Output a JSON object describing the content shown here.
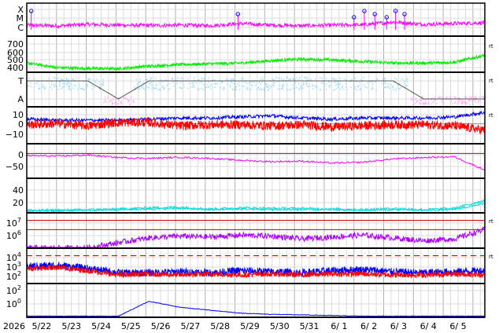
{
  "chart_data": {
    "type": "line",
    "x_axis": {
      "year_label": "2026",
      "day_labels": [
        "5/22",
        "5/23",
        "5/24",
        "5/25",
        "5/26",
        "5/27",
        "5/28",
        "5/29",
        "5/30",
        "5/31",
        "6/ 1",
        "6/ 2",
        "6/ 3",
        "6/ 4",
        "6/ 5"
      ],
      "range_days": [
        0,
        15.4
      ]
    },
    "colors": {
      "magenta": "#ff00ff",
      "green": "#00ee00",
      "lightblue": "#99ddff",
      "pink": "#ffaaee",
      "blue": "#0000ff",
      "red": "#ff0000",
      "cyan": "#00dddd",
      "purple": "#aa00ff",
      "gray": "#555555"
    },
    "panels": [
      {
        "id": "xray-class",
        "tick_labels": [
          "X",
          "M",
          "C"
        ],
        "flare_peaks_day": [
          0.15,
          7.1,
          11.0,
          11.35,
          11.7,
          12.1,
          12.4,
          12.7
        ],
        "series": [
          {
            "color": "magenta",
            "values": [
              0.3,
              0.25,
              0.35,
              0.3,
              0.28,
              0.3,
              0.27,
              0.4,
              0.3,
              0.26,
              0.3,
              0.32,
              0.5,
              0.35,
              0.4,
              0.45
            ]
          }
        ]
      },
      {
        "id": "solar-wind-speed",
        "tick_labels": [
          "700",
          "600",
          "500",
          "400"
        ],
        "ylim": [
          300,
          750
        ],
        "right_label": "rt",
        "series": [
          {
            "color": "green",
            "values": [
              420,
              360,
              350,
              345,
              380,
              400,
              410,
              420,
              450,
              470,
              460,
              440,
              420,
              420,
              430,
              520
            ]
          }
        ]
      },
      {
        "id": "ace-state",
        "tick_labels": [
          "T",
          "A"
        ],
        "right_label": "rt",
        "series": [
          {
            "color": "gray",
            "values": [
              1,
              1,
              1,
              0,
              1,
              1,
              1,
              1,
              1,
              1,
              1,
              1,
              1,
              0,
              0,
              0
            ]
          }
        ]
      },
      {
        "id": "magnetic-field",
        "tick_labels": [
          "10",
          "0",
          "−10"
        ],
        "ylim": [
          -18,
          15
        ],
        "right_label": "rt",
        "series": [
          {
            "color": "blue",
            "values": [
              4,
              3,
              3,
              3,
              4,
              5,
              5,
              6,
              7,
              5,
              4,
              5,
              5,
              5,
              6,
              10
            ]
          },
          {
            "color": "red",
            "values": [
              -1,
              0,
              -2,
              1,
              1,
              -2,
              -1,
              -1,
              -2,
              -1,
              -3,
              -2,
              -1,
              -1,
              -2,
              -6
            ]
          }
        ]
      },
      {
        "id": "dst-index",
        "tick_labels": [
          "0",
          "−50"
        ],
        "ylim": [
          -90,
          35
        ],
        "series": [
          {
            "color": "magenta",
            "values": [
              -8,
              -10,
              -6,
              -15,
              -18,
              -14,
              -18,
              -25,
              -30,
              -28,
              -35,
              -32,
              -20,
              -15,
              -12,
              -60
            ]
          }
        ]
      },
      {
        "id": "kp-index",
        "tick_labels": [
          "40",
          "20"
        ],
        "ylim": [
          0,
          55
        ],
        "series": [
          {
            "color": "cyan",
            "values": [
              4,
              4,
              5,
              6,
              8,
              9,
              6,
              8,
              7,
              7,
              6,
              5,
              7,
              5,
              7,
              20
            ]
          },
          {
            "color": "cyan",
            "values": [
              3,
              3,
              4,
              5,
              6,
              7,
              5,
              6,
              5,
              5,
              5,
              4,
              5,
              4,
              5,
              15
            ]
          }
        ]
      },
      {
        "id": "electron-flux",
        "tick_labels": [
          "10^7",
          "10^6"
        ],
        "log_ylim": [
          4,
          7.8
        ],
        "thresholds_log": [
          7,
          6
        ],
        "right_label": "rt",
        "series": [
          {
            "color": "purple",
            "values": [
              4,
              4,
              4,
              4.6,
              5.1,
              5.3,
              5.2,
              5.4,
              5.3,
              5.0,
              5.2,
              5.4,
              5.1,
              4.8,
              5.0,
              6.0
            ]
          }
        ]
      },
      {
        "id": "proton-flux",
        "tick_labels": [
          "10^4",
          "10^3",
          "10^2"
        ],
        "log_ylim": [
          1.3,
          4.6
        ],
        "threshold_log": 3.9,
        "right_label": "rt",
        "series": [
          {
            "color": "blue",
            "values": [
              2.9,
              3.0,
              2.7,
              2.3,
              2.3,
              2.4,
              2.3,
              2.5,
              2.4,
              2.3,
              2.5,
              2.6,
              2.4,
              2.3,
              2.4,
              2.5
            ]
          },
          {
            "color": "red",
            "values": [
              2.7,
              2.8,
              2.5,
              2.1,
              2.2,
              2.1,
              2.2,
              2.1,
              2.2,
              2.1,
              2.2,
              2.2,
              2.1,
              2.1,
              2.2,
              2.1
            ]
          }
        ]
      },
      {
        "id": "high-energy-proton",
        "tick_labels": [
          "10^2",
          "10^0"
        ],
        "log_ylim": [
          -1.2,
          4.5
        ],
        "series": [
          {
            "color": "blue",
            "values": [
              -1,
              -1,
              -1,
              -1,
              1.5,
              0.5,
              0,
              -0.5,
              -0.7,
              -0.8,
              -0.9,
              -1,
              -1,
              -1,
              -1,
              -1
            ]
          }
        ]
      }
    ]
  }
}
